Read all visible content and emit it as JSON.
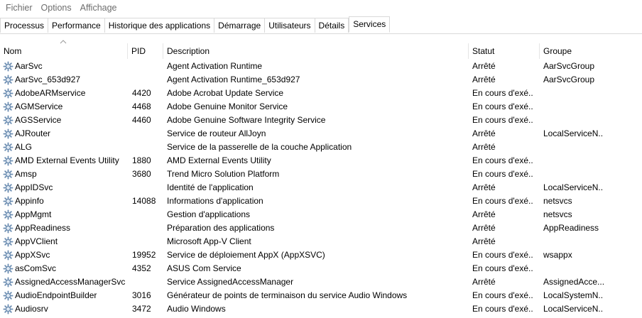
{
  "menu": {
    "file": "Fichier",
    "options": "Options",
    "view": "Affichage"
  },
  "tabs": [
    "Processus",
    "Performance",
    "Historique des applications",
    "Démarrage",
    "Utilisateurs",
    "Détails",
    "Services"
  ],
  "columns": {
    "name": "Nom",
    "pid": "PID",
    "description": "Description",
    "status": "Statut",
    "group": "Groupe"
  },
  "services": [
    {
      "name": "AarSvc",
      "pid": "",
      "description": "Agent Activation Runtime",
      "status": "Arrêté",
      "group": "AarSvcGroup"
    },
    {
      "name": "AarSvc_653d927",
      "pid": "",
      "description": "Agent Activation Runtime_653d927",
      "status": "Arrêté",
      "group": "AarSvcGroup"
    },
    {
      "name": "AdobeARMservice",
      "pid": "4420",
      "description": "Adobe Acrobat Update Service",
      "status": "En cours d'exé...",
      "group": ""
    },
    {
      "name": "AGMService",
      "pid": "4468",
      "description": "Adobe Genuine Monitor Service",
      "status": "En cours d'exé...",
      "group": ""
    },
    {
      "name": "AGSService",
      "pid": "4460",
      "description": "Adobe Genuine Software Integrity Service",
      "status": "En cours d'exé...",
      "group": ""
    },
    {
      "name": "AJRouter",
      "pid": "",
      "description": "Service de routeur AllJoyn",
      "status": "Arrêté",
      "group": "LocalServiceN..."
    },
    {
      "name": "ALG",
      "pid": "",
      "description": "Service de la passerelle de la couche Application",
      "status": "Arrêté",
      "group": ""
    },
    {
      "name": "AMD External Events Utility",
      "pid": "1880",
      "description": "AMD External Events Utility",
      "status": "En cours d'exé...",
      "group": ""
    },
    {
      "name": "Amsp",
      "pid": "3680",
      "description": "Trend Micro Solution Platform",
      "status": "En cours d'exé...",
      "group": ""
    },
    {
      "name": "AppIDSvc",
      "pid": "",
      "description": "Identité de l'application",
      "status": "Arrêté",
      "group": "LocalServiceN..."
    },
    {
      "name": "Appinfo",
      "pid": "14088",
      "description": "Informations d'application",
      "status": "En cours d'exé...",
      "group": "netsvcs"
    },
    {
      "name": "AppMgmt",
      "pid": "",
      "description": "Gestion d'applications",
      "status": "Arrêté",
      "group": "netsvcs"
    },
    {
      "name": "AppReadiness",
      "pid": "",
      "description": "Préparation des applications",
      "status": "Arrêté",
      "group": "AppReadiness"
    },
    {
      "name": "AppVClient",
      "pid": "",
      "description": "Microsoft App-V Client",
      "status": "Arrêté",
      "group": ""
    },
    {
      "name": "AppXSvc",
      "pid": "19952",
      "description": "Service de déploiement AppX (AppXSVC)",
      "status": "En cours d'exé...",
      "group": "wsappx"
    },
    {
      "name": "asComSvc",
      "pid": "4352",
      "description": "ASUS Com Service",
      "status": "En cours d'exé...",
      "group": ""
    },
    {
      "name": "AssignedAccessManagerSvc",
      "pid": "",
      "description": "Service AssignedAccessManager",
      "status": "Arrêté",
      "group": "AssignedAcce..."
    },
    {
      "name": "AudioEndpointBuilder",
      "pid": "3016",
      "description": "Générateur de points de terminaison du service Audio Windows",
      "status": "En cours d'exé...",
      "group": "LocalSystemN..."
    },
    {
      "name": "Audiosrv",
      "pid": "3472",
      "description": "Audio Windows",
      "status": "En cours d'exé...",
      "group": "LocalServiceN..."
    }
  ]
}
